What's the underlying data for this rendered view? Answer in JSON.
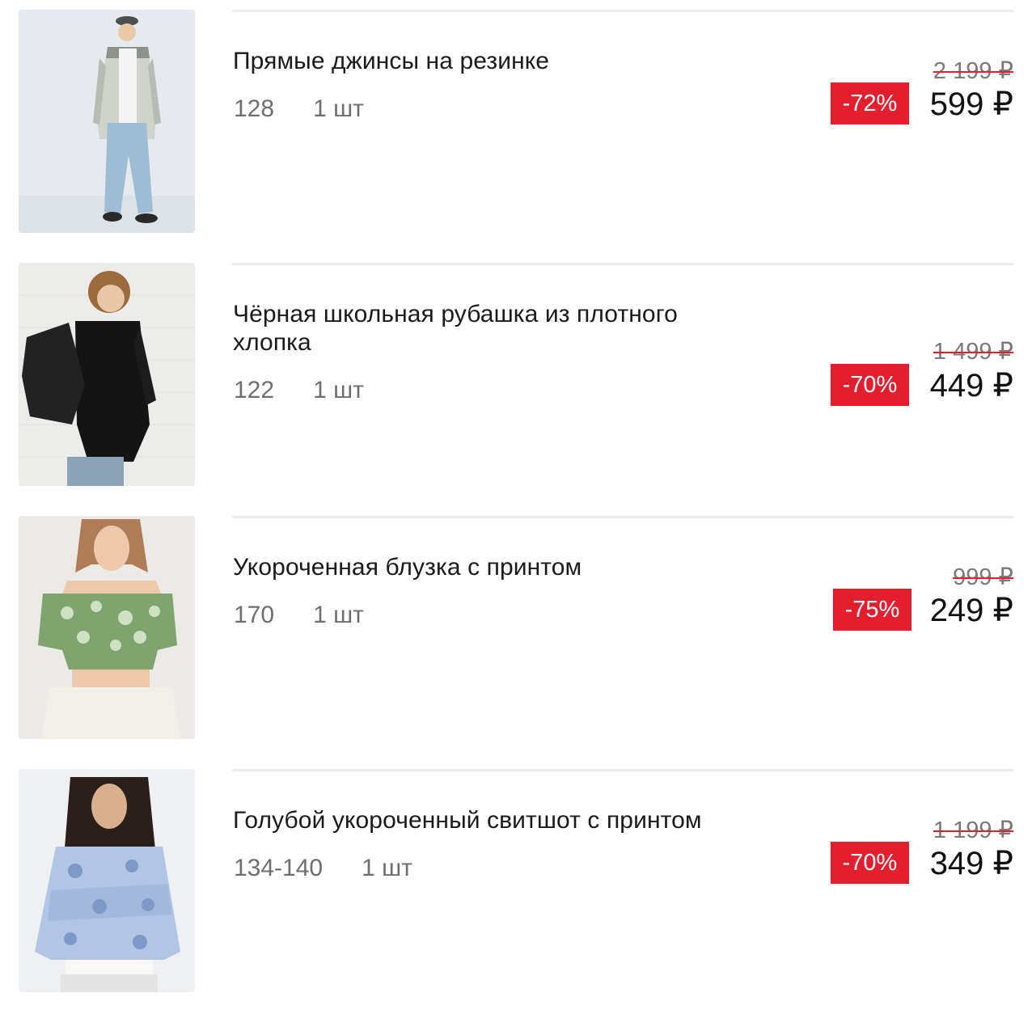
{
  "items": [
    {
      "title": "Прямые джинсы на резинке",
      "size": "128",
      "qty": "1 шт",
      "old_price": "2 199 ₽",
      "discount": "-72%",
      "price": "599 ₽"
    },
    {
      "title": "Чёрная школьная рубашка из плотного хлопка",
      "size": "122",
      "qty": "1 шт",
      "old_price": "1 499 ₽",
      "discount": "-70%",
      "price": "449 ₽"
    },
    {
      "title": "Укороченная блузка с принтом",
      "size": "170",
      "qty": "1 шт",
      "old_price": "999 ₽",
      "discount": "-75%",
      "price": "249 ₽"
    },
    {
      "title": "Голубой укороченный свитшот с принтом",
      "size": "134-140",
      "qty": "1 шт",
      "old_price": "1 199 ₽",
      "discount": "-70%",
      "price": "349 ₽"
    }
  ],
  "colors": {
    "discount_badge": "#e31e2d",
    "old_price_strike": "#e31e2d",
    "meta_text": "#6e6e6e",
    "divider": "#ececec"
  }
}
